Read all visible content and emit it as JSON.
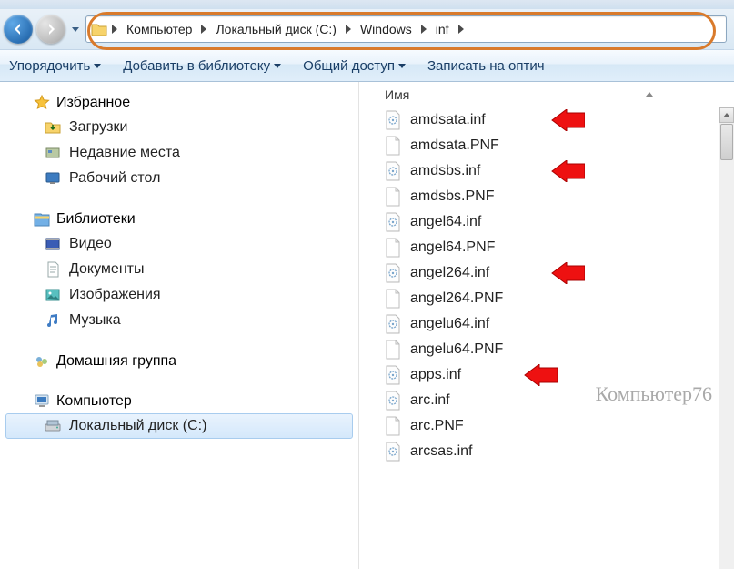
{
  "breadcrumb": {
    "items": [
      "Компьютер",
      "Локальный диск (C:)",
      "Windows",
      "inf"
    ]
  },
  "toolbar": {
    "organize": "Упорядочить",
    "library": "Добавить в библиотеку",
    "share": "Общий доступ",
    "burn": "Записать на оптич"
  },
  "sidebar": {
    "favorites": {
      "label": "Избранное",
      "items": [
        "Загрузки",
        "Недавние места",
        "Рабочий стол"
      ]
    },
    "libraries": {
      "label": "Библиотеки",
      "items": [
        "Видео",
        "Документы",
        "Изображения",
        "Музыка"
      ]
    },
    "homegroup": {
      "label": "Домашняя группа"
    },
    "computer": {
      "label": "Компьютер",
      "items": [
        "Локальный диск (C:)"
      ]
    }
  },
  "filelist": {
    "column": "Имя",
    "files": [
      {
        "name": "amdsata.inf",
        "type": "inf",
        "arrow": true
      },
      {
        "name": "amdsata.PNF",
        "type": "pnf",
        "arrow": false
      },
      {
        "name": "amdsbs.inf",
        "type": "inf",
        "arrow": true
      },
      {
        "name": "amdsbs.PNF",
        "type": "pnf",
        "arrow": false
      },
      {
        "name": "angel64.inf",
        "type": "inf",
        "arrow": false
      },
      {
        "name": "angel64.PNF",
        "type": "pnf",
        "arrow": false
      },
      {
        "name": "angel264.inf",
        "type": "inf",
        "arrow": true
      },
      {
        "name": "angel264.PNF",
        "type": "pnf",
        "arrow": false
      },
      {
        "name": "angelu64.inf",
        "type": "inf",
        "arrow": false
      },
      {
        "name": "angelu64.PNF",
        "type": "pnf",
        "arrow": false
      },
      {
        "name": "apps.inf",
        "type": "inf",
        "arrow": true,
        "arrowClose": true
      },
      {
        "name": "arc.inf",
        "type": "inf",
        "arrow": false
      },
      {
        "name": "arc.PNF",
        "type": "pnf",
        "arrow": false
      },
      {
        "name": "arcsas.inf",
        "type": "inf",
        "arrow": false
      }
    ]
  },
  "watermark": "Компьютер76"
}
